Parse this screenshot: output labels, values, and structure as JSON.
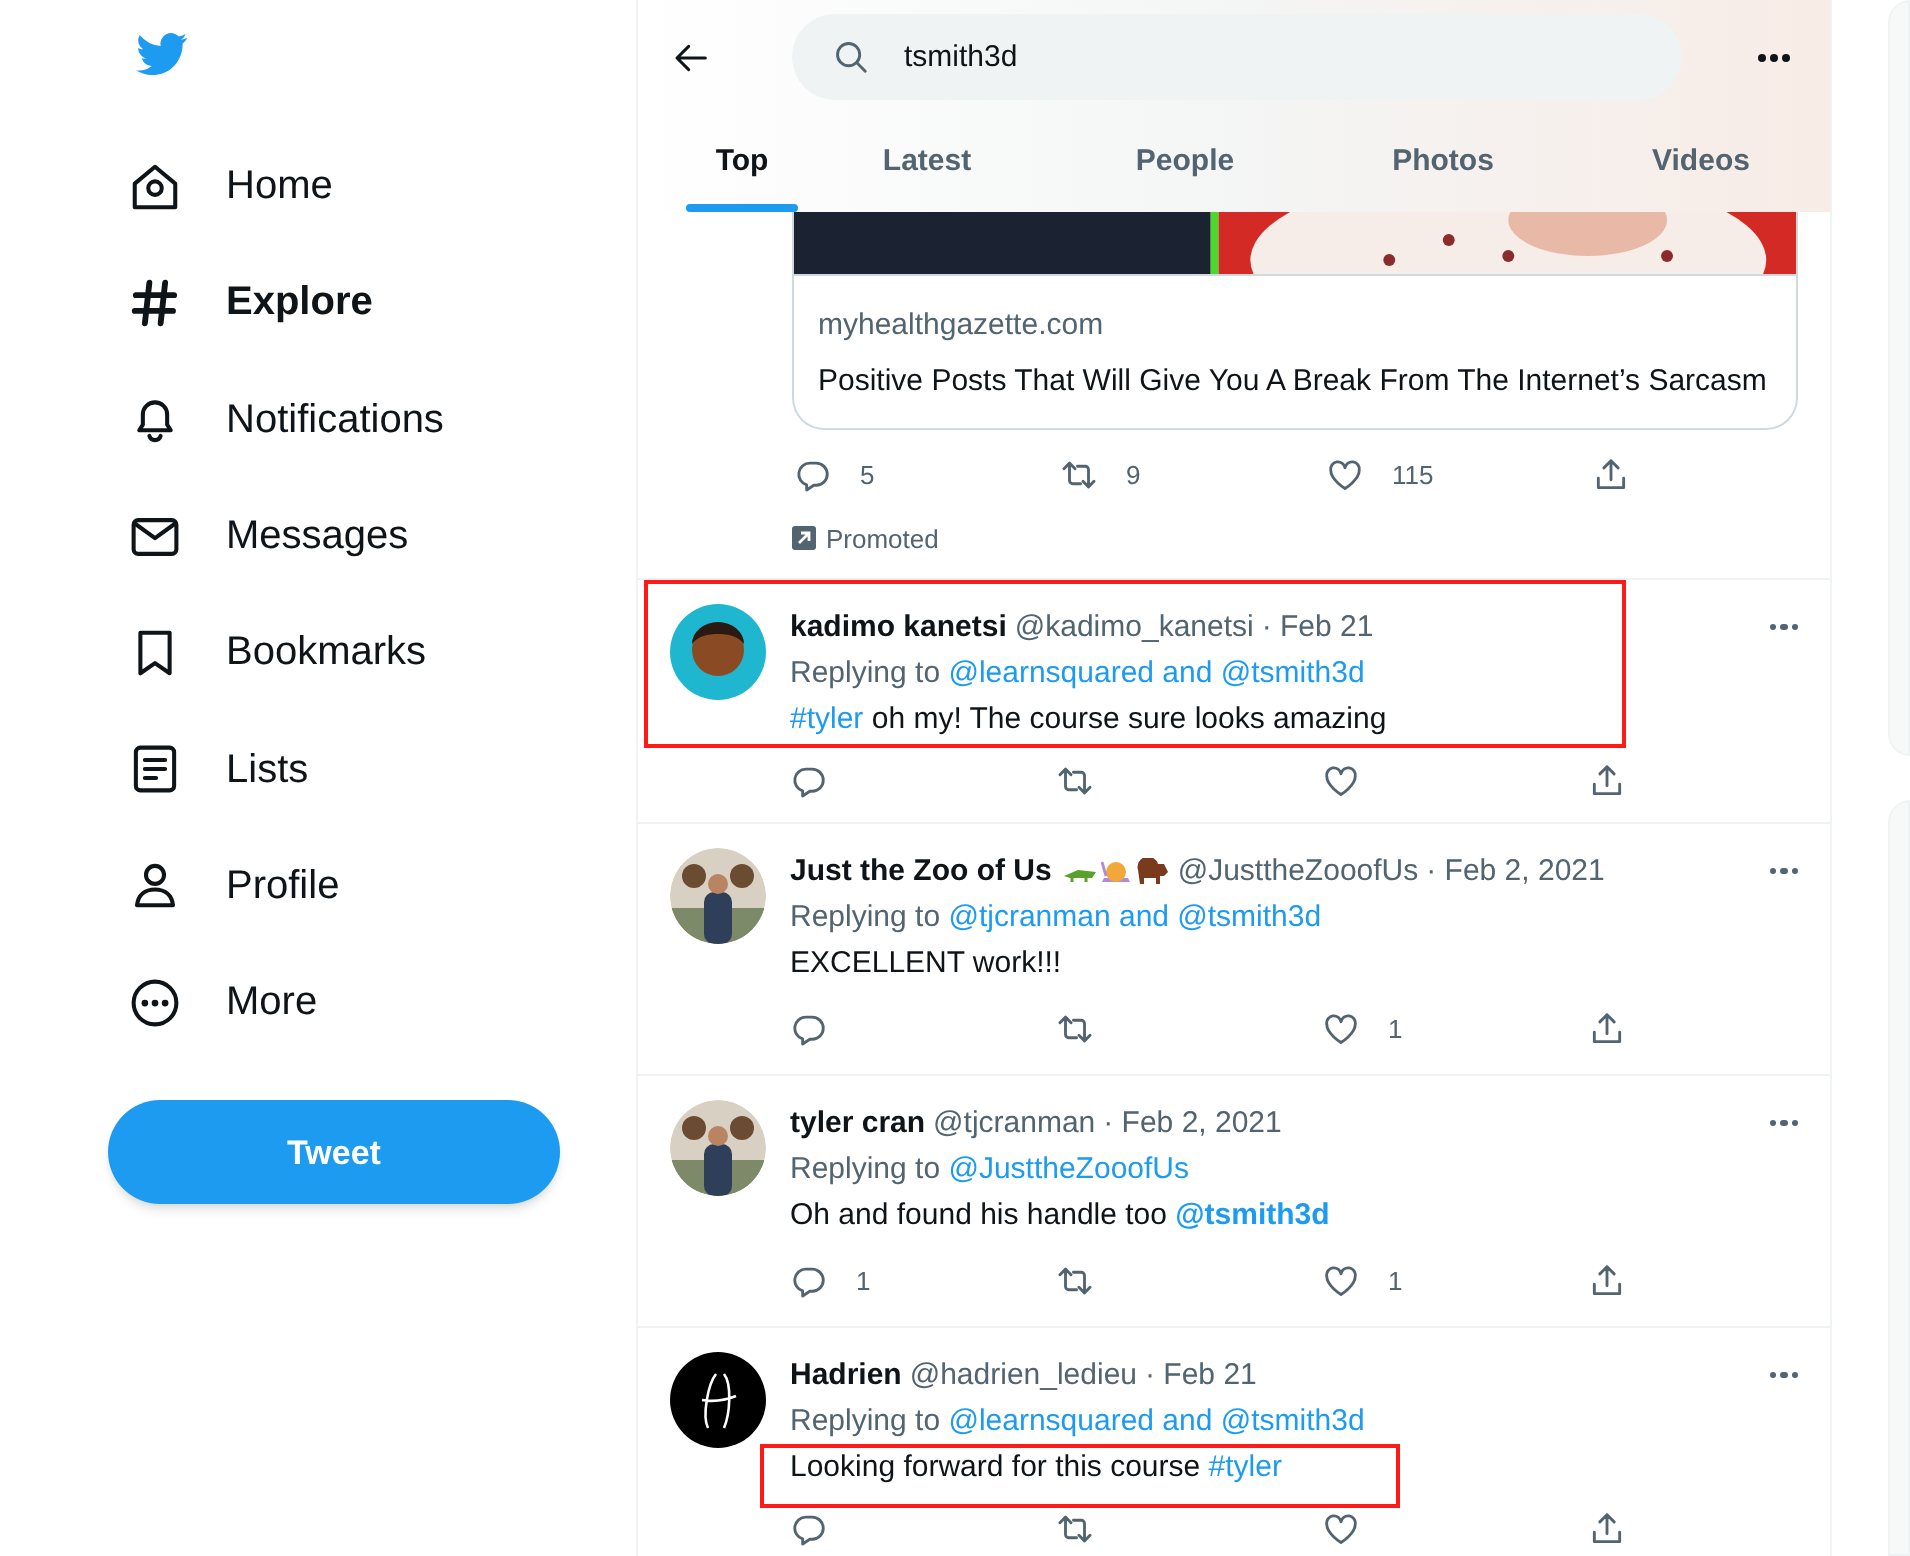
{
  "sidebar": {
    "nav": [
      {
        "label": "Home",
        "selected": false
      },
      {
        "label": "Explore",
        "selected": true
      },
      {
        "label": "Notifications",
        "selected": false
      },
      {
        "label": "Messages",
        "selected": false
      },
      {
        "label": "Bookmarks",
        "selected": false
      },
      {
        "label": "Lists",
        "selected": false
      },
      {
        "label": "Profile",
        "selected": false
      },
      {
        "label": "More",
        "selected": false
      }
    ],
    "tweet_button": "Tweet"
  },
  "header": {
    "search": {
      "value": "tsmith3d"
    },
    "tabs": [
      {
        "label": "Top",
        "selected": true
      },
      {
        "label": "Latest",
        "selected": false
      },
      {
        "label": "People",
        "selected": false
      },
      {
        "label": "Photos",
        "selected": false
      },
      {
        "label": "Videos",
        "selected": false
      }
    ]
  },
  "promoted": {
    "card": {
      "kind": "picture",
      "domain": "myhealthgazette.com",
      "title": "Positive Posts That Will Give You A Break From The Internet’s Sarcasm"
    },
    "counts": {
      "reply": "5",
      "retweet": "9",
      "like": "115"
    },
    "label": "Promoted"
  },
  "tweets": [
    {
      "name": "kadimo kanetsi",
      "emoji": false,
      "handle": "@kadimo_kanetsi",
      "date": "· Feb 21",
      "highlighted": true,
      "text_highlighted": false,
      "reply_to": [
        {
          "kind": "plain",
          "text": "Replying to "
        },
        {
          "kind": "link",
          "text": "@learnsquared and @tsmith3d"
        }
      ],
      "text": [
        {
          "kind": "link",
          "text": "#tyler"
        },
        {
          "kind": "plain",
          "text": " oh my! The course sure looks amazing"
        }
      ]
    },
    {
      "name": "Just the Zoo of Us",
      "emoji": true,
      "highlighted": false,
      "text_highlighted": false,
      "handle": "@JusttheZooofUs",
      "date": "· Feb 2, 2021",
      "reply_to": [
        {
          "kind": "plain",
          "text": "Replying to "
        },
        {
          "kind": "link",
          "text": "@tjcranman and @tsmith3d"
        }
      ],
      "text": [
        {
          "kind": "plain",
          "text": "EXCELLENT work!!!"
        }
      ],
      "counts": {
        "like": "1"
      }
    },
    {
      "name": "tyler cran",
      "emoji": false,
      "highlighted": false,
      "text_highlighted": false,
      "handle": "@tjcranman",
      "date": "· Feb 2, 2021",
      "reply_to": [
        {
          "kind": "plain",
          "text": "Replying to "
        },
        {
          "kind": "link",
          "text": "@JusttheZooofUs"
        }
      ],
      "text": [
        {
          "kind": "plain",
          "text": "Oh and found his handle too "
        },
        {
          "kind": "mention",
          "text": "@tsmith3d"
        }
      ],
      "counts": {
        "reply": "1",
        "like": "1"
      }
    },
    {
      "name": "Hadrien",
      "emoji": false,
      "highlighted": false,
      "text_highlighted": true,
      "handle": "@hadrien_ledieu",
      "date": "· Feb 21",
      "reply_to": [
        {
          "kind": "plain",
          "text": "Replying to "
        },
        {
          "kind": "link",
          "text": "@learnsquared and @tsmith3d"
        }
      ],
      "text": [
        {
          "kind": "plain",
          "text": "Looking forward for this course "
        },
        {
          "kind": "link",
          "text": "#tyler"
        }
      ]
    }
  ]
}
